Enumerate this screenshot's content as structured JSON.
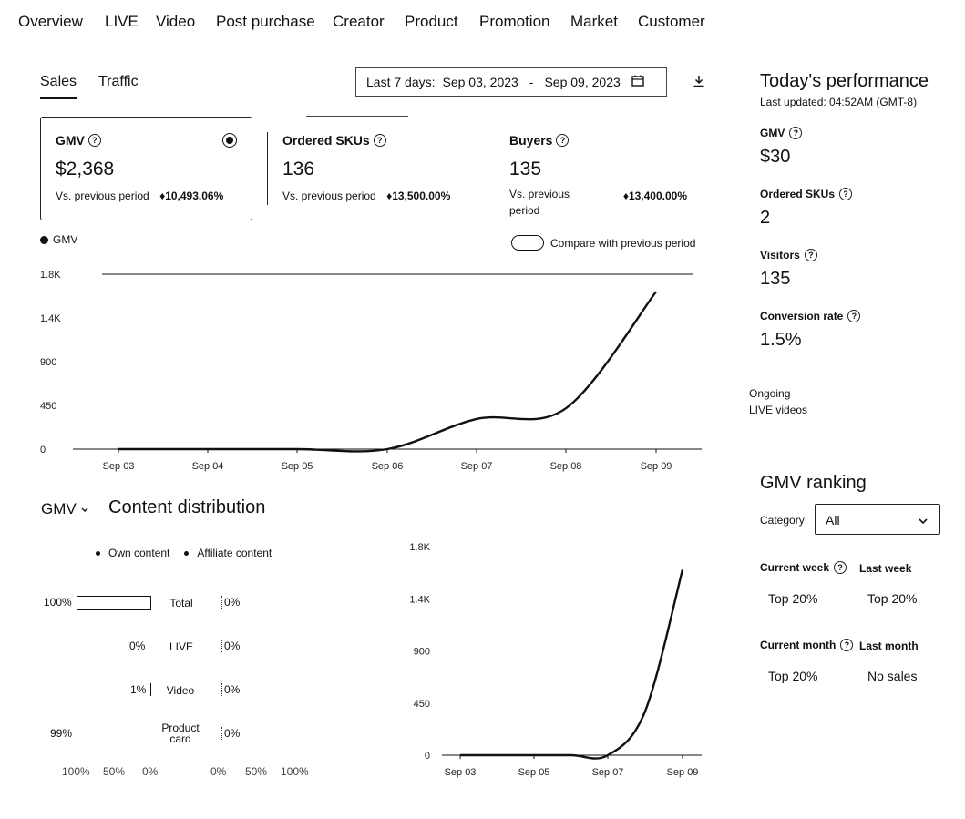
{
  "nav": [
    "Overview",
    "LIVE",
    "Video",
    "Post purchase",
    "Creator",
    "Product",
    "Promotion",
    "Market",
    "Customer"
  ],
  "tabs": {
    "sales": "Sales",
    "traffic": "Traffic"
  },
  "date_range": {
    "label": "Last 7 days:",
    "start": "Sep 03, 2023",
    "sep": "-",
    "end": "Sep 09, 2023"
  },
  "metrics": {
    "gmv": {
      "title": "GMV",
      "value": "$2,368",
      "compare": "Vs. previous period",
      "delta": "10,493.06%"
    },
    "skus": {
      "title": "Ordered SKUs",
      "value": "136",
      "compare": "Vs. previous period",
      "delta": "13,500.00%"
    },
    "buyers": {
      "title": "Buyers",
      "value": "135",
      "compare": "Vs. previous period",
      "delta": "13,400.00%"
    }
  },
  "legend_gmv": "GMV",
  "compare_toggle": "Compare with previous period",
  "chart_data": [
    {
      "type": "line",
      "x": [
        "Sep 03",
        "Sep 04",
        "Sep 05",
        "Sep 06",
        "Sep 07",
        "Sep 08",
        "Sep 09"
      ],
      "series": [
        {
          "name": "GMV",
          "values": [
            0,
            0,
            0,
            0,
            310,
            420,
            1620
          ]
        }
      ],
      "yticks": [
        "0",
        "450",
        "900",
        "1.4K",
        "1.8K"
      ],
      "ylim": [
        0,
        1800
      ]
    },
    {
      "type": "line",
      "x": [
        "Sep 03",
        "Sep 05",
        "Sep 07",
        "Sep 09"
      ],
      "series": [
        {
          "values": [
            0,
            0,
            0,
            0,
            0,
            380,
            1600
          ]
        }
      ],
      "yticks": [
        "0",
        "450",
        "900",
        "1.4K",
        "1.8K"
      ],
      "ylim": [
        0,
        1800
      ]
    }
  ],
  "content": {
    "selector": "GMV",
    "title": "Content distribution",
    "legend": [
      "Own content",
      "Affiliate content"
    ],
    "rows": [
      {
        "left": "100%",
        "label": "Total",
        "right": "0%"
      },
      {
        "left": "0%",
        "label": "LIVE",
        "right": "0%"
      },
      {
        "left": "1%",
        "label": "Video",
        "right": "0%"
      },
      {
        "left": "99%",
        "label": "Product card",
        "right": "0%"
      }
    ],
    "axis": [
      "100%",
      "50%",
      "0%",
      "0%",
      "50%",
      "100%"
    ]
  },
  "today": {
    "title": "Today's performance",
    "updated": "Last updated: 04:52AM (GMT-8)",
    "gmv_label": "GMV",
    "gmv": "$30",
    "skus_label": "Ordered SKUs",
    "skus": "2",
    "visitors_label": "Visitors",
    "visitors": "135",
    "conv_label": "Conversion rate",
    "conv": "1.5%",
    "ongoing1": "Ongoing",
    "ongoing2": "LIVE videos"
  },
  "ranking": {
    "title": "GMV ranking",
    "category_label": "Category",
    "category_value": "All",
    "current_week": "Current week",
    "last_week": "Last week",
    "cw_val": "Top 20%",
    "lw_val": "Top 20%",
    "current_month": "Current month",
    "last_month": "Last month",
    "cm_val": "Top 20%",
    "lm_val": "No sales"
  }
}
